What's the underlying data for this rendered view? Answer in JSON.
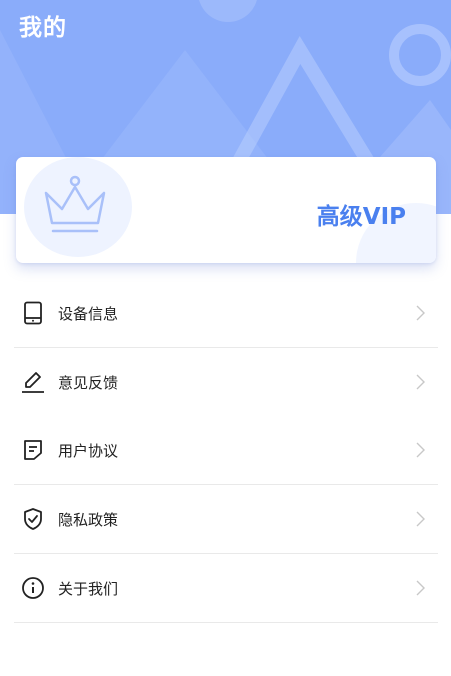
{
  "header": {
    "title": "我的"
  },
  "vip_card": {
    "label": "高级VIP",
    "icon": "crown-icon"
  },
  "menu": {
    "items": [
      {
        "label": "设备信息",
        "icon": "phone-icon"
      },
      {
        "label": "意见反馈",
        "icon": "edit-icon"
      },
      {
        "label": "用户协议",
        "icon": "document-icon"
      },
      {
        "label": "隐私政策",
        "icon": "shield-check-icon"
      },
      {
        "label": "关于我们",
        "icon": "info-icon"
      }
    ]
  },
  "colors": {
    "header_bg": "#8aacfa",
    "accent": "#4a80ef",
    "icon": "#222222",
    "chevron": "#c8c8c8"
  }
}
